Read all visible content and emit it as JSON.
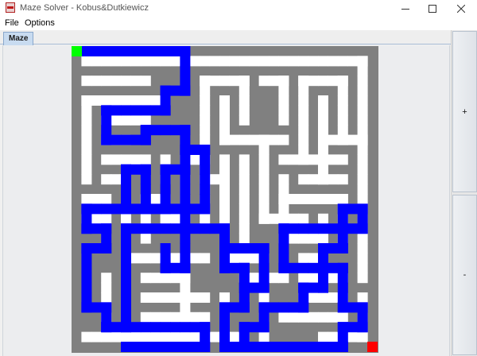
{
  "window": {
    "title": "Maze Solver - Kobus&Dutkiewicz"
  },
  "menu": {
    "file": "File",
    "options": "Options"
  },
  "tabs": [
    {
      "label": "Maze",
      "selected": true
    }
  ],
  "side_buttons": {
    "zoom_in": "+",
    "zoom_out": "-"
  },
  "colors": {
    "wall": "#808080",
    "path": "#ffffff",
    "solution": "#0000ff",
    "start": "#00ff00",
    "end": "#ff0000"
  },
  "icons": {
    "app": "maze-app-icon",
    "minimize": "minimize-icon",
    "maximize": "maximize-icon",
    "close": "close-icon"
  }
}
